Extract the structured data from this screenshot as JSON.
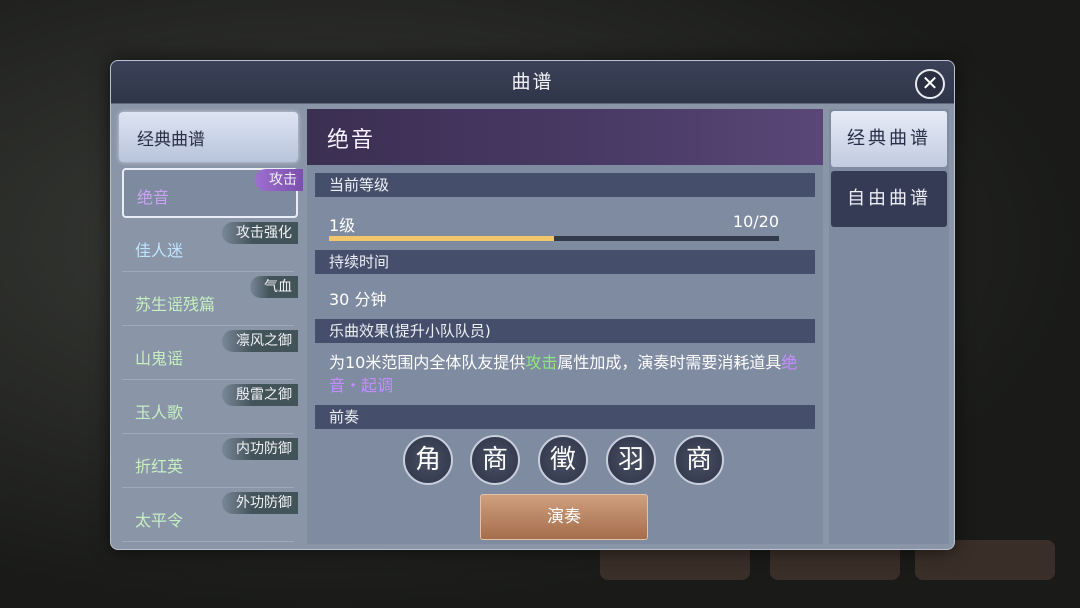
{
  "dialog": {
    "title": "曲谱"
  },
  "left_list": {
    "header": "经典曲谱",
    "items": [
      {
        "name": "绝音",
        "tag": "攻击"
      },
      {
        "name": "佳人迷",
        "tag": "攻击强化"
      },
      {
        "name": "苏生谣残篇",
        "tag": "气血"
      },
      {
        "name": "山鬼谣",
        "tag": "凛风之御"
      },
      {
        "name": "玉人歌",
        "tag": "殷雷之御"
      },
      {
        "name": "折红英",
        "tag": "内功防御"
      },
      {
        "name": "太平令",
        "tag": "外功防御"
      }
    ]
  },
  "detail": {
    "title": "绝音",
    "level_label": "当前等级",
    "level_value": "1级",
    "progress_text": "10/20",
    "progress": {
      "current": 10,
      "max": 20
    },
    "duration_label": "持续时间",
    "duration_value": "30 分钟",
    "effect_label": "乐曲效果(提升小队队员)",
    "effect_parts": {
      "p1": "为10米范围内全体队友提供",
      "h1": "攻击",
      "p2": "属性加成，演奏时需要消耗道具",
      "h2": "绝音・起调"
    },
    "prelude_label": "前奏",
    "notes": [
      "角",
      "商",
      "徵",
      "羽",
      "商"
    ],
    "play_button": "演奏"
  },
  "tabs": {
    "classic": "经典曲谱",
    "free": "自由曲谱"
  },
  "colors": {
    "accent_purple": "#c48cff",
    "highlight_green": "#8ee87e",
    "progress_gold": "#f2c66a"
  }
}
